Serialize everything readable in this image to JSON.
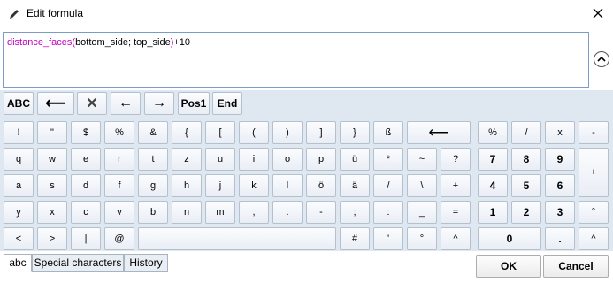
{
  "window": {
    "title": "Edit formula",
    "title_icon": "pencil-icon",
    "close_icon": "close-icon"
  },
  "formula": {
    "function_name": "distance_faces",
    "open_paren": "(",
    "args": "bottom_side; top_side",
    "close_paren": ")",
    "suffix": "+10"
  },
  "toolbar": {
    "abc": "ABC",
    "backspace": "⟵",
    "clear": "✕",
    "left": "←",
    "right": "→",
    "pos1": "Pos1",
    "end": "End"
  },
  "keys": {
    "row1": [
      "!",
      "\"",
      "$",
      "%",
      "&",
      "{",
      "[",
      "(",
      ")",
      "]",
      "}",
      "ß",
      "⟵"
    ],
    "row2": [
      "q",
      "w",
      "e",
      "r",
      "t",
      "z",
      "u",
      "i",
      "o",
      "p",
      "ü",
      "*",
      "~",
      "?"
    ],
    "row3": [
      "a",
      "s",
      "d",
      "f",
      "g",
      "h",
      "j",
      "k",
      "l",
      "ö",
      "ä",
      "/",
      "\\",
      "+"
    ],
    "row4": [
      "y",
      "x",
      "c",
      "v",
      "b",
      "n",
      "m",
      ",",
      ".",
      "-",
      ";",
      ":",
      "_",
      "="
    ],
    "row5": [
      "<",
      ">",
      "|",
      "@",
      "",
      "#",
      "'",
      "°",
      "^"
    ]
  },
  "numpad": {
    "row1": [
      "%",
      "/",
      "x",
      "-"
    ],
    "row2": [
      "7",
      "8",
      "9"
    ],
    "row3": [
      "4",
      "5",
      "6"
    ],
    "row4": [
      "1",
      "2",
      "3",
      "°"
    ],
    "row5": [
      "0",
      ".",
      "^"
    ],
    "plus": "+"
  },
  "tabs": [
    "abc",
    "Special characters",
    "History"
  ],
  "buttons": {
    "ok": "OK",
    "cancel": "Cancel"
  }
}
